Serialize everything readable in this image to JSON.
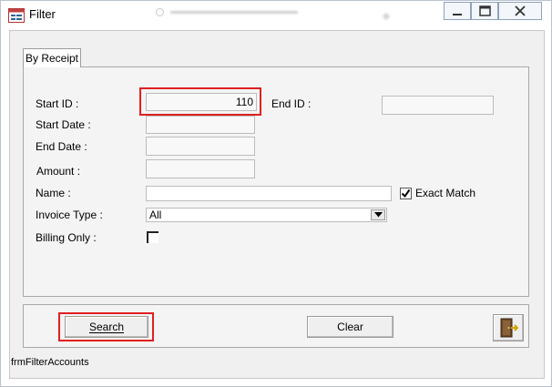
{
  "window": {
    "title": "Filter",
    "form_name": "frmFilterAccounts",
    "controls": {
      "minimize": "minimize",
      "maximize": "maximize",
      "close": "close"
    }
  },
  "tab": {
    "label": "By Receipt"
  },
  "fields": {
    "start_id": {
      "label": "Start ID :",
      "value": "110"
    },
    "end_id": {
      "label": "End ID :",
      "value": ""
    },
    "start_date": {
      "label": "Start Date :",
      "value": ""
    },
    "end_date": {
      "label": "End Date :",
      "value": ""
    },
    "amount": {
      "label": "Amount :",
      "value": ""
    },
    "name": {
      "label": "Name :",
      "value": ""
    },
    "exact_match": {
      "label": "Exact Match",
      "checked": true
    },
    "invoice_type": {
      "label": "Invoice Type :",
      "selected": "All"
    },
    "billing_only": {
      "label": "Billing Only :",
      "checked": false
    }
  },
  "buttons": {
    "search": "Search",
    "clear": "Clear",
    "exit": "exit-door-icon"
  },
  "colors": {
    "highlight": "#e02020",
    "panel": "#f4f4f4",
    "field": "#f8f8f8"
  }
}
